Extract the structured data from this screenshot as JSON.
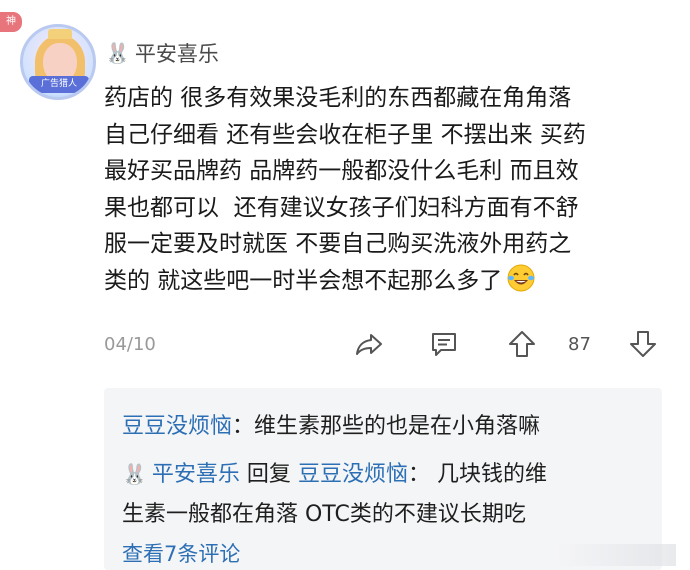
{
  "badge": {
    "label": "神"
  },
  "author": {
    "avatar_ribbon": "广告猎人",
    "name": "平安喜乐",
    "name_icon": "rabbit-icon"
  },
  "comment": {
    "text": "药店的 很多有效果没毛利的东西都藏在角角落\n自己仔细看 还有些会收在柜子里 不摆出来 买药\n最好买品牌药 品牌药一般都没什么毛利 而且效\n果也都可以  还有建议女孩子们妇科方面有不舒\n服一定要及时就医 不要自己购买洗液外用药之\n类的 就这些吧一时半会想不起那么多了",
    "emoji": "laughing-tears-emoji",
    "date": "04/10",
    "like_count": "87"
  },
  "actions": {
    "share_icon": "share-icon",
    "reply_icon": "comment-icon",
    "upvote_icon": "upvote-icon",
    "downvote_icon": "downvote-icon"
  },
  "replies": [
    {
      "user": "豆豆没烦恼",
      "separator": "：",
      "text": "维生素那些的也是在小角落嘛"
    },
    {
      "user": "平安喜乐",
      "reply_word": "回复",
      "reply_to": "豆豆没烦恼",
      "separator": "：",
      "text_line1": "几块钱的维",
      "text_line2": "生素一般都在角落 OTC类的不建议长期吃"
    }
  ],
  "view_more": "查看7条评论",
  "colors": {
    "link_blue": "#2d6fb5",
    "reply_bg": "#f4f5f7",
    "badge_red": "#e8747c"
  }
}
